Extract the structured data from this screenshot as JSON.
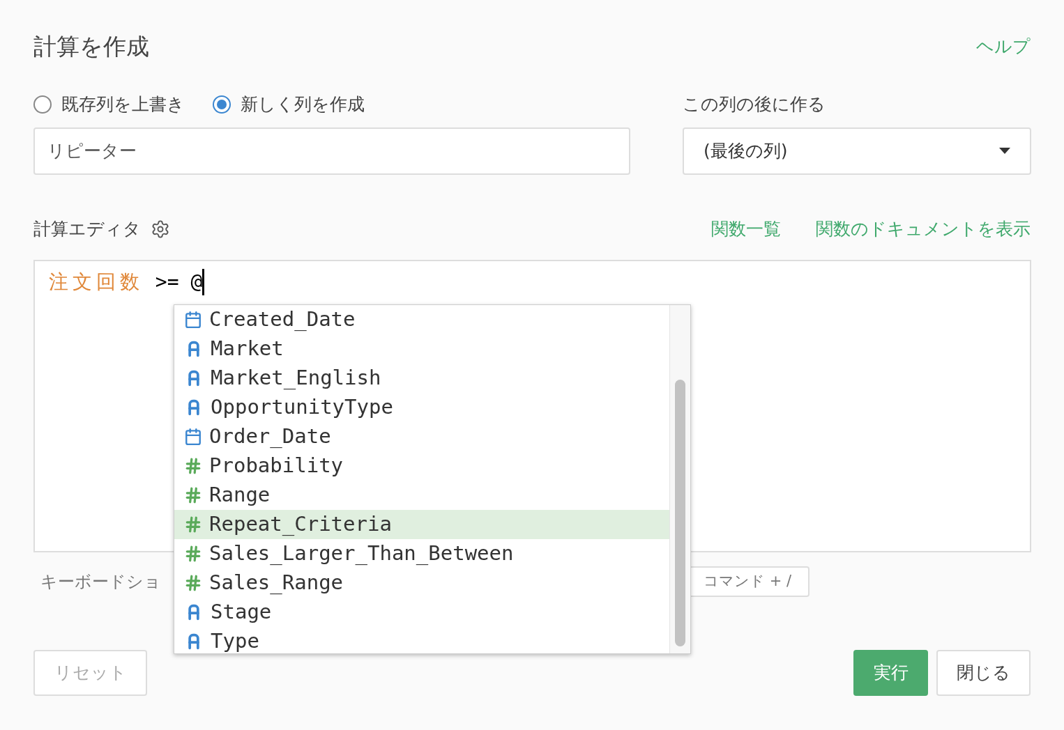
{
  "dialog": {
    "title": "計算を作成",
    "help_link": "ヘルプ"
  },
  "mode_options": [
    {
      "label": "既存列を上書き",
      "selected": false
    },
    {
      "label": "新しく列を作成",
      "selected": true
    }
  ],
  "column_name": {
    "value": "リピーター"
  },
  "position": {
    "label": "この列の後に作る",
    "value": "(最後の列)"
  },
  "editor": {
    "label": "計算エディタ",
    "links": [
      "関数一覧",
      "関数のドキュメントを表示"
    ],
    "column_token": "注文回数",
    "expression": " >= @"
  },
  "autocomplete": [
    {
      "kind": "date",
      "name": "Created_Date",
      "selected": false
    },
    {
      "kind": "text",
      "name": "Market",
      "selected": false
    },
    {
      "kind": "text",
      "name": "Market_English",
      "selected": false
    },
    {
      "kind": "text",
      "name": "OpportunityType",
      "selected": false
    },
    {
      "kind": "date",
      "name": "Order_Date",
      "selected": false
    },
    {
      "kind": "number",
      "name": "Probability",
      "selected": false
    },
    {
      "kind": "number",
      "name": "Range",
      "selected": false
    },
    {
      "kind": "number",
      "name": "Repeat_Criteria",
      "selected": true
    },
    {
      "kind": "number",
      "name": "Sales_Larger_Than_Between",
      "selected": false
    },
    {
      "kind": "number",
      "name": "Sales_Range",
      "selected": false
    },
    {
      "kind": "text",
      "name": "Stage",
      "selected": false
    },
    {
      "kind": "text",
      "name": "Type",
      "selected": false
    }
  ],
  "shortcut": {
    "label": "キーボードショ",
    "key": "コマンド + /"
  },
  "buttons": {
    "reset": "リセット",
    "run": "実行",
    "close": "閉じる"
  }
}
